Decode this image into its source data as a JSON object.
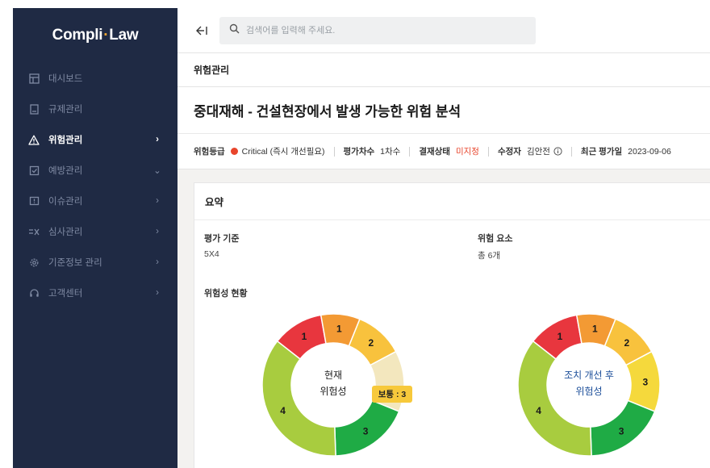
{
  "app": {
    "logo_left": "Compli",
    "logo_dot": "·",
    "logo_right": "Law"
  },
  "sidebar": {
    "items": [
      {
        "label": "대시보드",
        "icon": "dashboard-icon",
        "arrow": ""
      },
      {
        "label": "규제관리",
        "icon": "document-icon",
        "arrow": ""
      },
      {
        "label": "위험관리",
        "icon": "warning-icon",
        "arrow": "›",
        "active": true
      },
      {
        "label": "예방관리",
        "icon": "checkbox-icon",
        "arrow": "⌄"
      },
      {
        "label": "이슈관리",
        "icon": "issue-icon",
        "arrow": "›"
      },
      {
        "label": "심사관리",
        "icon": "review-icon",
        "arrow": "›"
      },
      {
        "label": "기준정보 관리",
        "icon": "gear-icon",
        "arrow": "›"
      },
      {
        "label": "고객센터",
        "icon": "headset-icon",
        "arrow": "›"
      }
    ]
  },
  "header": {
    "search_placeholder": "검색어를 입력해 주세요."
  },
  "breadcrumb": "위험관리",
  "page_title": "중대재해 - 건설현장에서 발생 가능한 위험 분석",
  "meta": {
    "grade_label": "위험등급",
    "grade_value": "Critical (즉시 개선필요)",
    "round_label": "평가차수",
    "round_value": "1차수",
    "approval_label": "결재상태",
    "approval_value": "미지정",
    "editor_label": "수정자",
    "editor_value": "김안전",
    "date_label": "최근 평가일",
    "date_value": "2023-09-06"
  },
  "summary": {
    "title": "요약",
    "criteria_label": "평가 기준",
    "criteria_value": "5X4",
    "elements_label": "위험 요소",
    "elements_value": "총 6개",
    "status_label": "위험성 현황",
    "current": {
      "center_line1": "현재",
      "center_line2": "위험성",
      "badge": "보통 : 3",
      "segments": [
        {
          "value": "1",
          "color": "#e8363e"
        },
        {
          "value": "1",
          "color": "#f39a34"
        },
        {
          "value": "2",
          "color": "#f8c23d"
        },
        {
          "value": "",
          "color": "#f3e7be"
        },
        {
          "value": "3",
          "color": "#1fab45"
        },
        {
          "value": "4",
          "color": "#a8cc3f"
        }
      ]
    },
    "after": {
      "center_line1": "조치 개선 후",
      "center_line2": "위험성",
      "segments": [
        {
          "value": "1",
          "color": "#e8363e"
        },
        {
          "value": "1",
          "color": "#f39a34"
        },
        {
          "value": "2",
          "color": "#f8c23d"
        },
        {
          "value": "3",
          "color": "#f5d93c"
        },
        {
          "value": "3",
          "color": "#1fab45"
        },
        {
          "value": "4",
          "color": "#a8cc3f"
        }
      ]
    }
  }
}
